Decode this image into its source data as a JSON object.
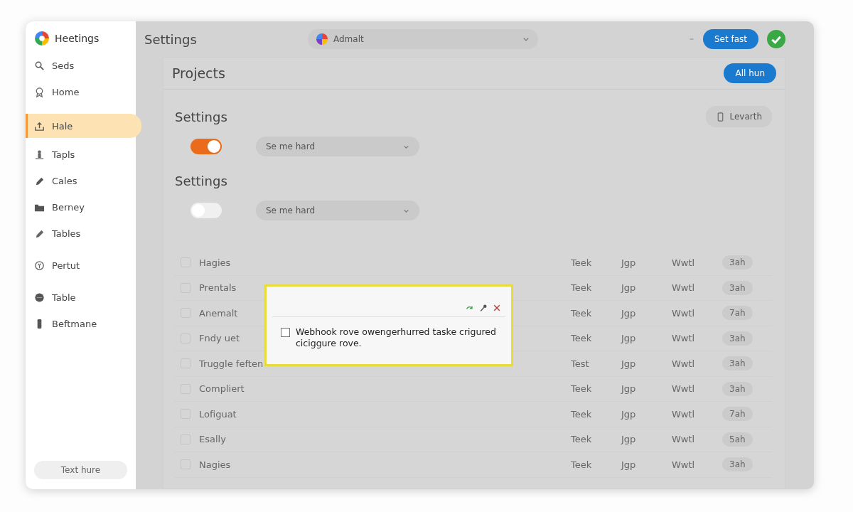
{
  "sidebar": {
    "brand": "Heetings",
    "items": [
      {
        "label": "Seds",
        "selected": false
      },
      {
        "label": "Home",
        "selected": false
      },
      {
        "label": "Hale",
        "selected": true
      },
      {
        "label": "Tapls",
        "selected": false
      },
      {
        "label": "Cales",
        "selected": false
      },
      {
        "label": "Berney",
        "selected": false
      },
      {
        "label": "Tables",
        "selected": false
      },
      {
        "label": "Pertut",
        "selected": false
      },
      {
        "label": "Table",
        "selected": false
      },
      {
        "label": "Beftmane",
        "selected": false
      }
    ],
    "footer_button": "Text hure"
  },
  "topbar": {
    "title": "Settings",
    "selector": "Admalt",
    "button": "Set fast"
  },
  "panel": {
    "title": "Projects",
    "button": "All hun",
    "sections": [
      {
        "title": "Settings",
        "button": "Levarth",
        "toggle_on": true,
        "select": "Se me hard"
      },
      {
        "title": "Settings",
        "toggle_on": false,
        "select": "Se me hard"
      }
    ],
    "rows": [
      {
        "name": "Hagies",
        "checked": false,
        "column_2": "Teek",
        "column_3": "Jgp",
        "column_4": "Wwtl",
        "badge": "3ah"
      },
      {
        "name": "Prentals",
        "checked": false,
        "column_2": "Teek",
        "column_3": "Jgp",
        "column_4": "Wwtl",
        "badge": "3ah"
      },
      {
        "name": "Anemalt",
        "checked": false,
        "column_2": "Teek",
        "column_3": "Jgp",
        "column_4": "Wwtl",
        "badge": "7ah"
      },
      {
        "name": "Fndy uet",
        "checked": false,
        "column_2": "Teek",
        "column_3": "Jgp",
        "column_4": "Wwtl",
        "badge": "3ah"
      },
      {
        "name": "Truggle feften",
        "checked": false,
        "column_2": "Test",
        "column_3": "Jgp",
        "column_4": "Wwtl",
        "badge": "3ah"
      },
      {
        "name": "Compliert",
        "checked": false,
        "column_2": "Teek",
        "column_3": "Jgp",
        "column_4": "Wwtl",
        "badge": "3ah"
      },
      {
        "name": "Lofiguat",
        "checked": false,
        "column_2": "Teek",
        "column_3": "Jgp",
        "column_4": "Wwtl",
        "badge": "7ah"
      },
      {
        "name": "Esally",
        "checked": false,
        "column_2": "Teek",
        "column_3": "Jgp",
        "column_4": "Wwtl",
        "badge": "5ah"
      },
      {
        "name": "Nagies",
        "checked": false,
        "column_2": "Teek",
        "column_3": "Jgp",
        "column_4": "Wwtl",
        "badge": "3ah"
      }
    ]
  },
  "popup": {
    "checked": false,
    "text": "Webhook rove owengerhurred taske crigured ciciggure rove."
  }
}
